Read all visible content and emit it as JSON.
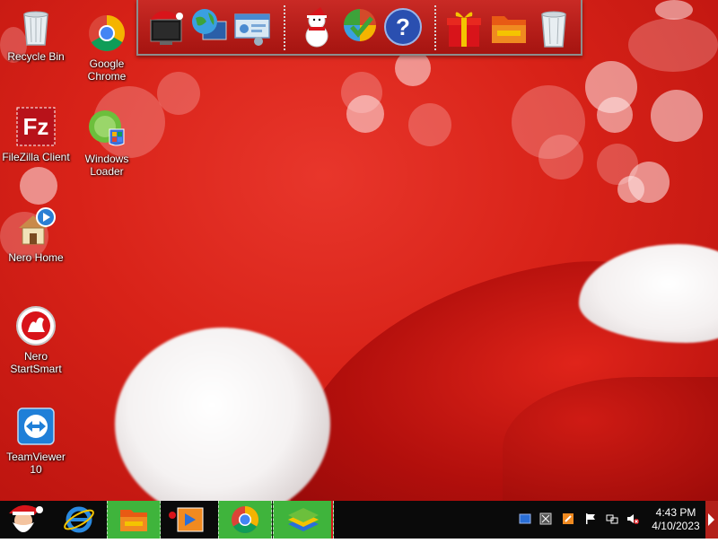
{
  "desktop_icons": [
    {
      "label": "Recycle Bin",
      "icon": "recycle-bin-icon"
    },
    {
      "label": "Google Chrome",
      "icon": "chrome-icon"
    },
    {
      "label": "FileZilla Client",
      "icon": "filezilla-icon"
    },
    {
      "label": "Windows Loader",
      "icon": "windows-loader-icon"
    },
    {
      "label": "Nero Home",
      "icon": "nero-home-icon"
    },
    {
      "label": "Nero StartSmart",
      "icon": "nero-startsmart-icon"
    },
    {
      "label": "TeamViewer 10",
      "icon": "teamviewer-icon"
    }
  ],
  "dock": {
    "items": [
      "santa-computer-icon",
      "network-globe-icon",
      "control-panel-icon",
      "snowman-icon",
      "windows-orb-icon",
      "help-icon",
      "gift-icon",
      "folder-icon",
      "recycle-bin-icon"
    ]
  },
  "taskbar": {
    "start_icon": "santa-start-icon",
    "items": [
      "internet-explorer-icon",
      "file-explorer-icon",
      "media-player-icon",
      "chrome-icon",
      "bluestacks-icon"
    ],
    "active_color": "#3fb43c"
  },
  "tray": {
    "time": "4:43 PM",
    "date": "4/10/2023",
    "icons": [
      "vmware-icon",
      "virtualbox-icon",
      "app-icon",
      "flag-icon",
      "network-icon",
      "volume-muted-icon"
    ]
  },
  "colors": {
    "wallpaper": "#d82218",
    "taskbar": "#0a0a0a"
  }
}
